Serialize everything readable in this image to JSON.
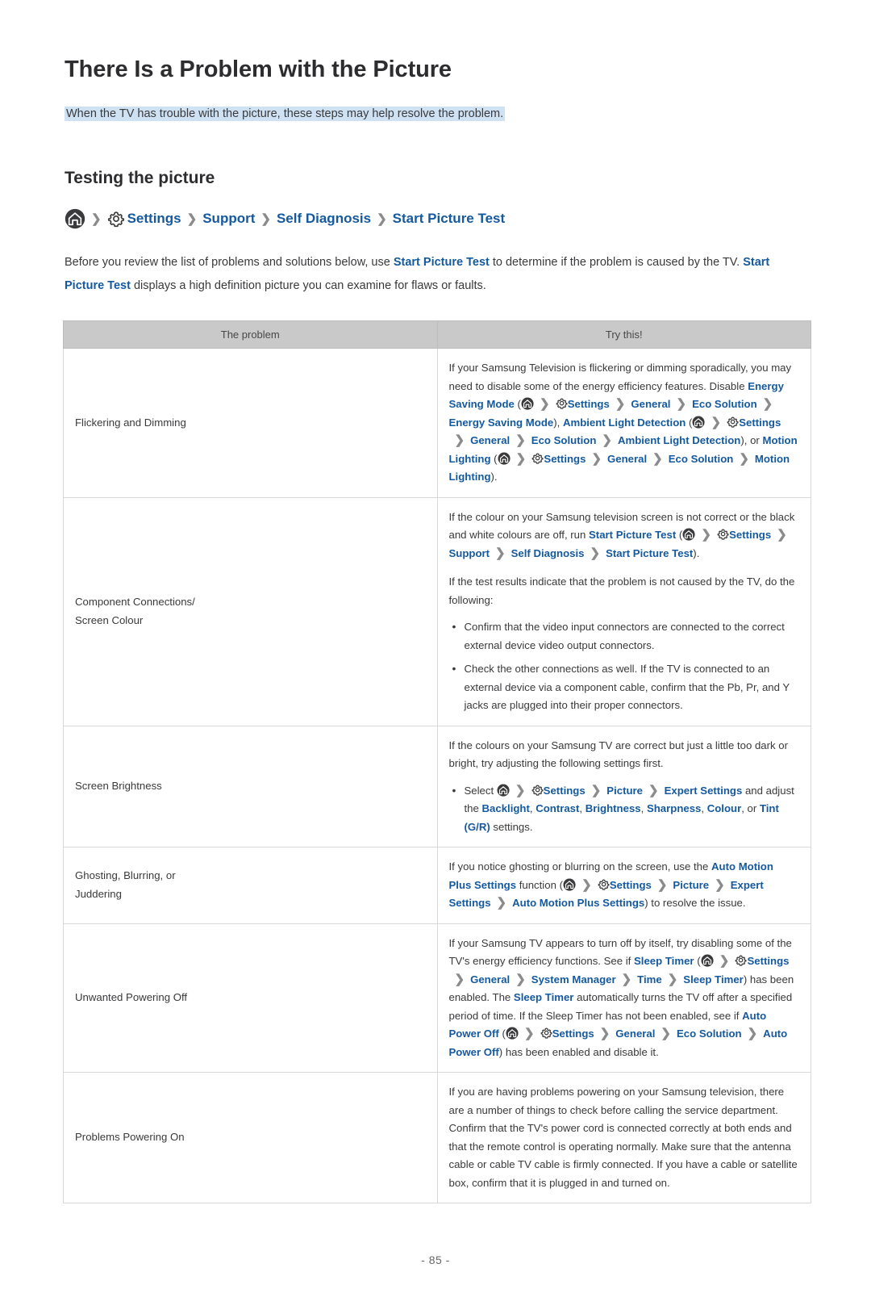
{
  "page": {
    "title": "There Is a Problem with the Picture",
    "intro": "When the TV has trouble with the picture, these steps may help resolve the problem.",
    "section_title": "Testing the picture",
    "page_number": "- 85 -",
    "accent_blue": "#15599e",
    "highlight_blue": "#cfe2f3",
    "table_header_gray": "#c9c9c9"
  },
  "breadcrumb": {
    "home_icon": "home-icon",
    "gear_icon": "gear-icon",
    "separator": "❯",
    "items": [
      {
        "label": "Settings"
      },
      {
        "label": "Support"
      },
      {
        "label": "Self Diagnosis"
      },
      {
        "label": "Start Picture Test"
      }
    ]
  },
  "body_paragraph": {
    "part1": "Before you review the list of problems and solutions below, use ",
    "link1": "Start Picture Test",
    "part2": " to determine if the problem is caused by the TV. ",
    "link2": "Start Picture Test",
    "part3": " displays a high definition picture you can examine for flaws or faults."
  },
  "table": {
    "headers": [
      "The problem",
      "Try this!"
    ],
    "rows": [
      {
        "problem": "Flickering and Dimming",
        "solution": {
          "p1_a": "If your Samsung Television is flickering or dimming sporadically, you may need to disable some of the energy efficiency features. Disable ",
          "l1": "Energy Saving Mode",
          "p1_b": " (",
          "path1": [
            "Settings",
            "General",
            "Eco Solution",
            "Energy Saving Mode"
          ],
          "p1_c": "), ",
          "l2": "Ambient Light Detection",
          "p1_d": " (",
          "path2": [
            "Settings",
            "General",
            "Eco Solution",
            "Ambient Light Detection"
          ],
          "p1_e": "), or ",
          "l3": "Motion Lighting",
          "p1_f": " (",
          "path3": [
            "Settings",
            "General",
            "Eco Solution",
            "Motion Lighting"
          ],
          "p1_g": ")."
        }
      },
      {
        "problem": "Component Connections/ Screen Colour",
        "problem_line1": "Component Connections/",
        "problem_line2": "Screen Colour",
        "solution": {
          "p1_a": "If the colour on your Samsung television screen is not correct or the black and white colours are off, run ",
          "l1": "Start Picture Test",
          "p1_b": " (",
          "path1": [
            "Settings",
            "Support",
            "Self Diagnosis",
            "Start Picture Test"
          ],
          "p1_c": ").",
          "p2": "If the test results indicate that the problem is not caused by the TV, do the following:",
          "bullets": [
            "Confirm that the video input connectors are connected to the correct external device video output connectors.",
            "Check the other connections as well. If the TV is connected to an external device via a component cable, confirm that the Pb, Pr, and Y jacks are plugged into their proper connectors."
          ]
        }
      },
      {
        "problem": "Screen Brightness",
        "solution": {
          "p1": "If the colours on your Samsung TV are correct but just a little too dark or bright, try adjusting the following settings first.",
          "bullet_a": "Select ",
          "path1": [
            "Settings",
            "Picture",
            "Expert Settings"
          ],
          "bullet_b": " and adjust the ",
          "links": [
            "Backlight",
            "Contrast",
            "Brightness",
            "Sharpness",
            "Colour",
            "Tint (G/R)"
          ],
          "bullet_c": " settings."
        }
      },
      {
        "problem": "Ghosting, Blurring, or Juddering",
        "problem_line1": "Ghosting, Blurring, or",
        "problem_line2": "Juddering",
        "solution": {
          "p1_a": "If you notice ghosting or blurring on the screen, use the ",
          "l1": "Auto Motion Plus Settings",
          "p1_b": " function (",
          "path1": [
            "Settings",
            "Picture",
            "Expert Settings",
            "Auto Motion Plus Settings"
          ],
          "p1_c": ") to resolve the issue."
        }
      },
      {
        "problem": "Unwanted Powering Off",
        "solution": {
          "p1_a": "If your Samsung TV appears to turn off by itself, try disabling some of the TV's energy efficiency functions. See if ",
          "l1": "Sleep Timer",
          "p1_b": " (",
          "path1": [
            "Settings",
            "General",
            "System Manager",
            "Time",
            "Sleep Timer"
          ],
          "p1_c": ") has been enabled. The ",
          "l2": "Sleep Timer",
          "p1_d": " automatically turns the TV off after a specified period of time. If the Sleep Timer has not been enabled, see if ",
          "l3": "Auto Power Off",
          "p1_e": " (",
          "path2": [
            "Settings",
            "General",
            "Eco Solution",
            "Auto Power Off"
          ],
          "p1_f": ") has been enabled and disable it."
        }
      },
      {
        "problem": "Problems Powering On",
        "solution": {
          "p1": "If you are having problems powering on your Samsung television, there are a number of things to check before calling the service department. Confirm that the TV's power cord is connected correctly at both ends and that the remote control is operating normally. Make sure that the antenna cable or cable TV cable is firmly connected. If you have a cable or satellite box, confirm that it is plugged in and turned on."
        }
      }
    ]
  }
}
